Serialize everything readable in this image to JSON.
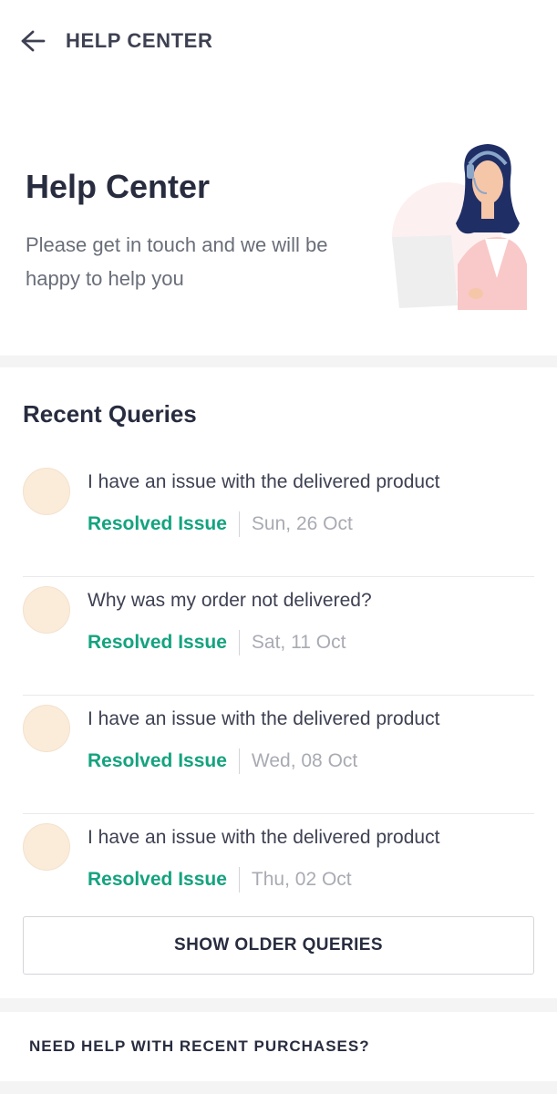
{
  "header": {
    "title": "HELP CENTER",
    "back_icon": "arrow-left-icon"
  },
  "hero": {
    "title": "Help Center",
    "subtitle": "Please get in touch and we will be happy to help you",
    "illustration": "support-agent-illustration"
  },
  "queries": {
    "title": "Recent Queries",
    "items": [
      {
        "text": "I have an issue with the delivered product",
        "status": "Resolved Issue",
        "date": "Sun, 26 Oct"
      },
      {
        "text": "Why was my order not delivered?",
        "status": "Resolved Issue",
        "date": "Sat, 11 Oct"
      },
      {
        "text": "I have an issue with the delivered product",
        "status": "Resolved Issue",
        "date": "Wed, 08 Oct"
      },
      {
        "text": "I have an issue with the delivered product",
        "status": "Resolved Issue",
        "date": "Thu, 02 Oct"
      }
    ],
    "older_button": "SHOW OLDER QUERIES"
  },
  "help": {
    "title": "NEED HELP WITH RECENT PURCHASES?"
  },
  "colors": {
    "status": "#14a37f",
    "avatar": "#fbebd9",
    "text": "#282c3f"
  }
}
